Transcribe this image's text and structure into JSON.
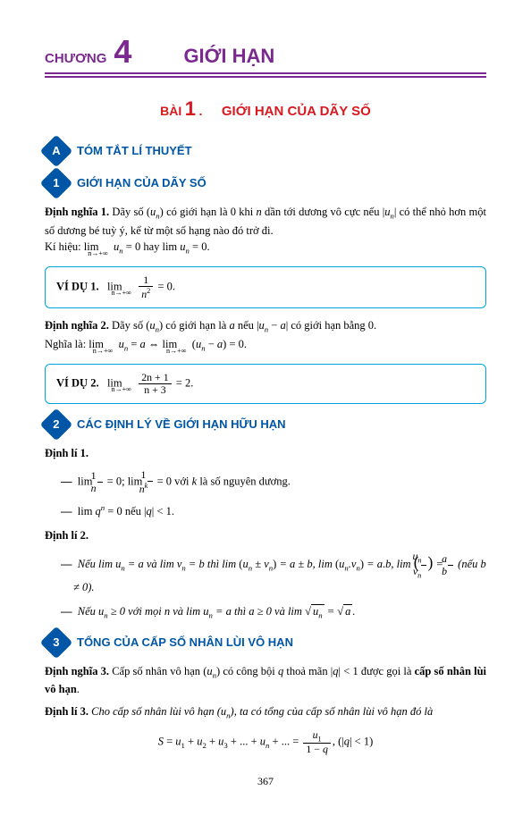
{
  "chapter": {
    "label": "CHƯƠNG",
    "num": "4",
    "title": "GIỚI HẠN"
  },
  "lesson": {
    "label": "BÀI",
    "num": "1",
    "dot": ".",
    "title": "GIỚI HẠN CỦA DÃY SỐ"
  },
  "secA": {
    "letter": "A",
    "title": "TÓM TẮT LÍ THUYẾT"
  },
  "sec1": {
    "num": "1",
    "title": "GIỚI HẠN CỦA DÃY SỐ"
  },
  "def1": {
    "label": "Định nghĩa 1.",
    "t1": " Dãy số (",
    "un": "u",
    "nsub": "n",
    "t2": ") có giới hạn là 0 khi ",
    "nvar": "n",
    "t3": " dần tới dương vô cực nếu |",
    "t4": "| có thể nhỏ hơn một số dương bé tuỳ ý, kể từ một số hạng nào đó trở đi.",
    "kihieu": "Kí hiệu: ",
    "lim": "lim",
    "ninf": "n→+∞",
    "eq": " = 0 hay lim ",
    "eq2": " = 0."
  },
  "ex1": {
    "label": "VÍ DỤ 1.",
    "lim": "lim",
    "ninf": "n→+∞",
    "num": "1",
    "den_n": "n",
    "den_exp": "2",
    "eq": " = 0."
  },
  "def2": {
    "label": "Định nghĩa 2.",
    "t1": " Dãy số (",
    "t2": ") có giới hạn là ",
    "a": "a",
    "t3": " nếu |",
    "minus": " − ",
    "t4": "| có giới hạn bằng 0.",
    "nghia": "Nghĩa là: ",
    "lim": "lim",
    "ninf": "n→+∞",
    "eqa": " = ",
    "iff": " ⇔ ",
    "par1": "(",
    "par2": ")",
    "eq0": " = 0."
  },
  "ex2": {
    "label": "VÍ DỤ 2.",
    "lim": "lim",
    "ninf": "n→+∞",
    "num": "2n + 1",
    "den": "n + 3",
    "eq": " = 2."
  },
  "sec2": {
    "num": "2",
    "title": "CÁC ĐỊNH LÝ VỀ GIỚI HẠN HỮU HẠN"
  },
  "thm1": {
    "label": "Định lí 1.",
    "i1_lim": "lim",
    "i1_num": "1",
    "i1_den": "n",
    "i1_eq0": " = 0; ",
    "i1_denk_n": "n",
    "i1_denk_k": "k",
    "i1_t": " = 0 với ",
    "i1_k": "k",
    "i1_t2": " là số nguyên dương.",
    "i2_lim": "lim ",
    "i2_q": "q",
    "i2_n": "n",
    "i2_t": " = 0 nếu |",
    "i2_t2": "| < 1."
  },
  "thm2": {
    "label": "Định lí 2.",
    "i1_t1": "Nếu ",
    "i1_lim": "lim ",
    "i1_un": "u",
    "i1_n": "n",
    "i1_eqa": " = ",
    "i1_a": "a",
    "i1_and": " và ",
    "i1_vn": "v",
    "i1_eqb": " = ",
    "i1_b": "b",
    "i1_thi": " thì ",
    "i1_pm": " ± ",
    "i1_dot": ".",
    "i1_comma": ", ",
    "i1_neu": " (nếu ",
    "i1_bne0": " ≠ 0).",
    "i2_t1": "Nếu ",
    "i2_ge0": " ≥ 0 ",
    "i2_moi": "với mọi ",
    "i2_n": "n",
    "i2_va": " và ",
    "i2_lim": "lim ",
    "i2_eqa": " = ",
    "i2_a": "a",
    "i2_thi": " thì ",
    "i2_age0": " ≥ 0 và ",
    "i2_sqrt": "√",
    "i2_dot": "."
  },
  "sec3": {
    "num": "3",
    "title": "TỔNG CỦA CẤP SỐ NHÂN LÙI VÔ HẠN"
  },
  "def3": {
    "label": "Định nghĩa 3.",
    "t1": " Cấp số nhân vô hạn (",
    "t2": ") có công bội ",
    "q": "q",
    "t3": " thoả mãn |",
    "t4": "| < 1 được gọi là ",
    "bold": "cấp số nhân lùi vô hạn",
    "dot": "."
  },
  "thm3": {
    "label": "Định lí 3.",
    "t1": " Cho cấp số nhân lùi vô hạn (",
    "t2": "), ta có tổng của cấp số nhân lùi vô hạn đó là",
    "S": "S",
    "eq": " = ",
    "u1": "u",
    "sub1": "1",
    "plus": " + ",
    "u2sub": "2",
    "u3sub": "3",
    "dots": " + ... + ",
    "unsub": "n",
    "dots2": " + ... = ",
    "den1": "1 − ",
    "q": "q",
    "comma": ", (|",
    "lt1": "| < 1)"
  },
  "page": "367"
}
